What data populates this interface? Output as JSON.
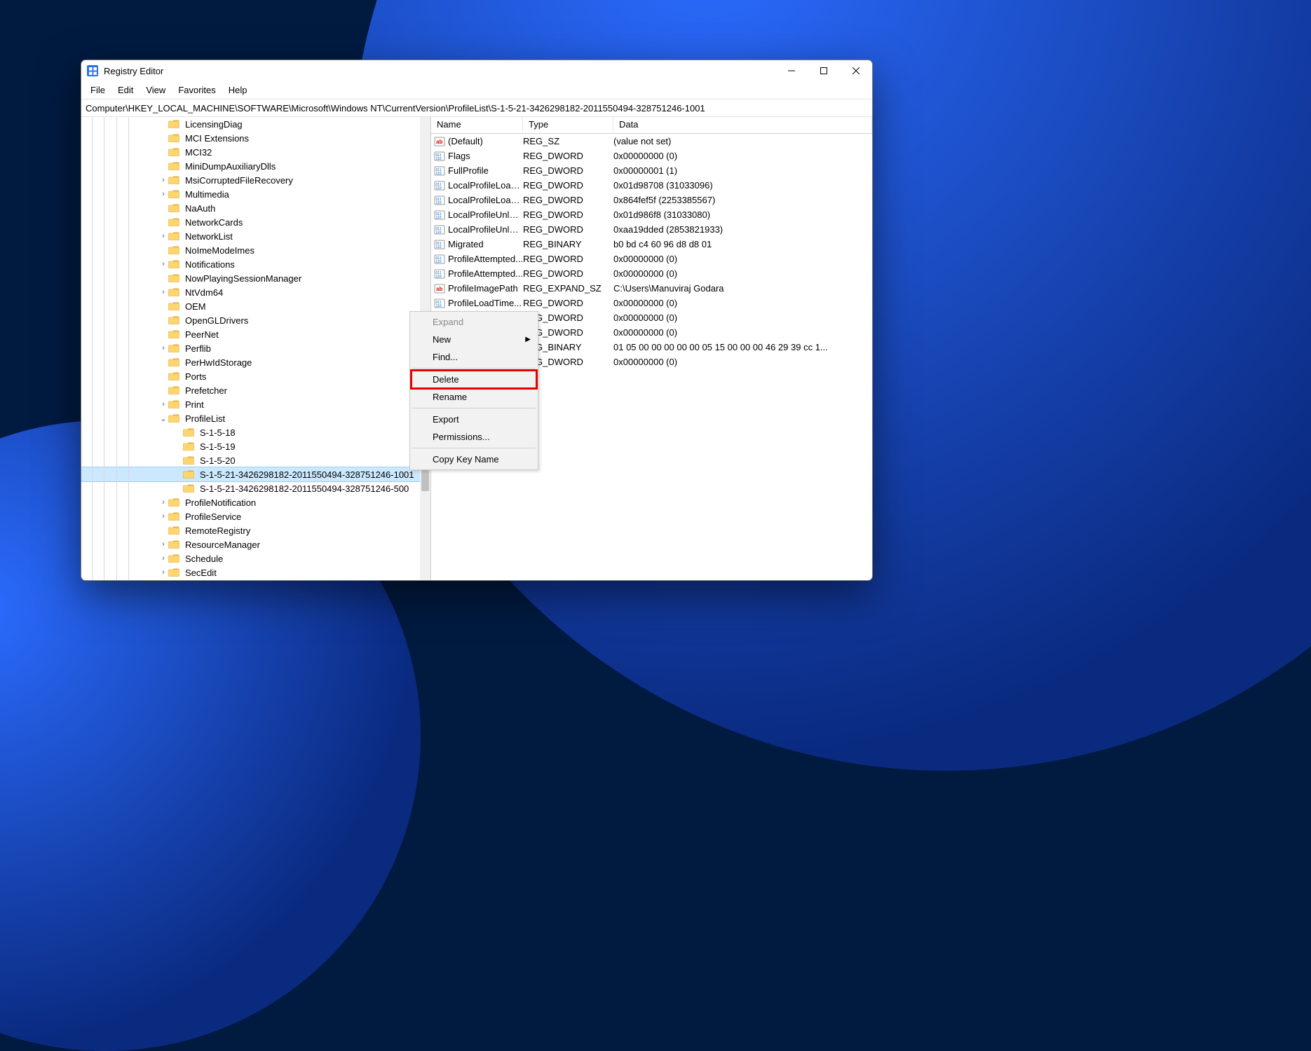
{
  "window": {
    "title": "Registry Editor",
    "minimize_tooltip": "Minimize",
    "maximize_tooltip": "Maximize",
    "close_tooltip": "Close"
  },
  "menu": {
    "file": "File",
    "edit": "Edit",
    "view": "View",
    "favorites": "Favorites",
    "help": "Help"
  },
  "address": "Computer\\HKEY_LOCAL_MACHINE\\SOFTWARE\\Microsoft\\Windows NT\\CurrentVersion\\ProfileList\\S-1-5-21-3426298182-2011550494-328751246-1001",
  "tree": [
    {
      "indent": 110,
      "tw": "",
      "label": "LicensingDiag"
    },
    {
      "indent": 110,
      "tw": "",
      "label": "MCI Extensions"
    },
    {
      "indent": 110,
      "tw": "",
      "label": "MCI32"
    },
    {
      "indent": 110,
      "tw": "",
      "label": "MiniDumpAuxiliaryDlls"
    },
    {
      "indent": 110,
      "tw": ">",
      "label": "MsiCorruptedFileRecovery"
    },
    {
      "indent": 110,
      "tw": ">",
      "label": "Multimedia"
    },
    {
      "indent": 110,
      "tw": "",
      "label": "NaAuth"
    },
    {
      "indent": 110,
      "tw": "",
      "label": "NetworkCards"
    },
    {
      "indent": 110,
      "tw": ">",
      "label": "NetworkList"
    },
    {
      "indent": 110,
      "tw": "",
      "label": "NoImeModeImes"
    },
    {
      "indent": 110,
      "tw": ">",
      "label": "Notifications"
    },
    {
      "indent": 110,
      "tw": "",
      "label": "NowPlayingSessionManager"
    },
    {
      "indent": 110,
      "tw": ">",
      "label": "NtVdm64"
    },
    {
      "indent": 110,
      "tw": "",
      "label": "OEM"
    },
    {
      "indent": 110,
      "tw": "",
      "label": "OpenGLDrivers"
    },
    {
      "indent": 110,
      "tw": "",
      "label": "PeerNet"
    },
    {
      "indent": 110,
      "tw": ">",
      "label": "Perflib"
    },
    {
      "indent": 110,
      "tw": "",
      "label": "PerHwIdStorage"
    },
    {
      "indent": 110,
      "tw": "",
      "label": "Ports"
    },
    {
      "indent": 110,
      "tw": "",
      "label": "Prefetcher"
    },
    {
      "indent": 110,
      "tw": ">",
      "label": "Print"
    },
    {
      "indent": 110,
      "tw": "v",
      "label": "ProfileList"
    },
    {
      "indent": 131,
      "tw": "",
      "label": "S-1-5-18"
    },
    {
      "indent": 131,
      "tw": "",
      "label": "S-1-5-19"
    },
    {
      "indent": 131,
      "tw": "",
      "label": "S-1-5-20"
    },
    {
      "indent": 131,
      "tw": "",
      "label": "S-1-5-21-3426298182-2011550494-328751246-1001",
      "selected": true
    },
    {
      "indent": 131,
      "tw": "",
      "label": "S-1-5-21-3426298182-2011550494-328751246-500"
    },
    {
      "indent": 110,
      "tw": ">",
      "label": "ProfileNotification"
    },
    {
      "indent": 110,
      "tw": ">",
      "label": "ProfileService"
    },
    {
      "indent": 110,
      "tw": "",
      "label": "RemoteRegistry"
    },
    {
      "indent": 110,
      "tw": ">",
      "label": "ResourceManager"
    },
    {
      "indent": 110,
      "tw": ">",
      "label": "Schedule"
    },
    {
      "indent": 110,
      "tw": ">",
      "label": "SecEdit"
    }
  ],
  "columns": {
    "name": "Name",
    "type": "Type",
    "data": "Data"
  },
  "values": [
    {
      "icon": "str",
      "name": "(Default)",
      "type": "REG_SZ",
      "data": "(value not set)"
    },
    {
      "icon": "bin",
      "name": "Flags",
      "type": "REG_DWORD",
      "data": "0x00000000 (0)"
    },
    {
      "icon": "bin",
      "name": "FullProfile",
      "type": "REG_DWORD",
      "data": "0x00000001 (1)"
    },
    {
      "icon": "bin",
      "name": "LocalProfileLoad...",
      "type": "REG_DWORD",
      "data": "0x01d98708 (31033096)"
    },
    {
      "icon": "bin",
      "name": "LocalProfileLoad...",
      "type": "REG_DWORD",
      "data": "0x864fef5f (2253385567)"
    },
    {
      "icon": "bin",
      "name": "LocalProfileUnloa...",
      "type": "REG_DWORD",
      "data": "0x01d986f8 (31033080)"
    },
    {
      "icon": "bin",
      "name": "LocalProfileUnloa...",
      "type": "REG_DWORD",
      "data": "0xaa19dded (2853821933)"
    },
    {
      "icon": "bin",
      "name": "Migrated",
      "type": "REG_BINARY",
      "data": "b0 bd c4 60 96 d8 d8 01"
    },
    {
      "icon": "bin",
      "name": "ProfileAttempted...",
      "type": "REG_DWORD",
      "data": "0x00000000 (0)"
    },
    {
      "icon": "bin",
      "name": "ProfileAttempted...",
      "type": "REG_DWORD",
      "data": "0x00000000 (0)"
    },
    {
      "icon": "str",
      "name": "ProfileImagePath",
      "type": "REG_EXPAND_SZ",
      "data": "C:\\Users\\Manuviraj Godara"
    },
    {
      "icon": "bin",
      "name": "ProfileLoadTime...",
      "type": "REG_DWORD",
      "data": "0x00000000 (0)"
    },
    {
      "icon": "bin",
      "name": "",
      "type": "REG_DWORD",
      "data": "0x00000000 (0)"
    },
    {
      "icon": "bin",
      "name": "",
      "type": "REG_DWORD",
      "data": "0x00000000 (0)"
    },
    {
      "icon": "bin",
      "name": "",
      "type": "REG_BINARY",
      "data": "01 05 00 00 00 00 00 05 15 00 00 00 46 29 39 cc 1..."
    },
    {
      "icon": "bin",
      "name": "",
      "type": "REG_DWORD",
      "data": "0x00000000 (0)"
    }
  ],
  "context_menu": {
    "expand": "Expand",
    "new": "New",
    "find": "Find...",
    "delete": "Delete",
    "rename": "Rename",
    "export": "Export",
    "permissions": "Permissions...",
    "copy_key_name": "Copy Key Name"
  }
}
